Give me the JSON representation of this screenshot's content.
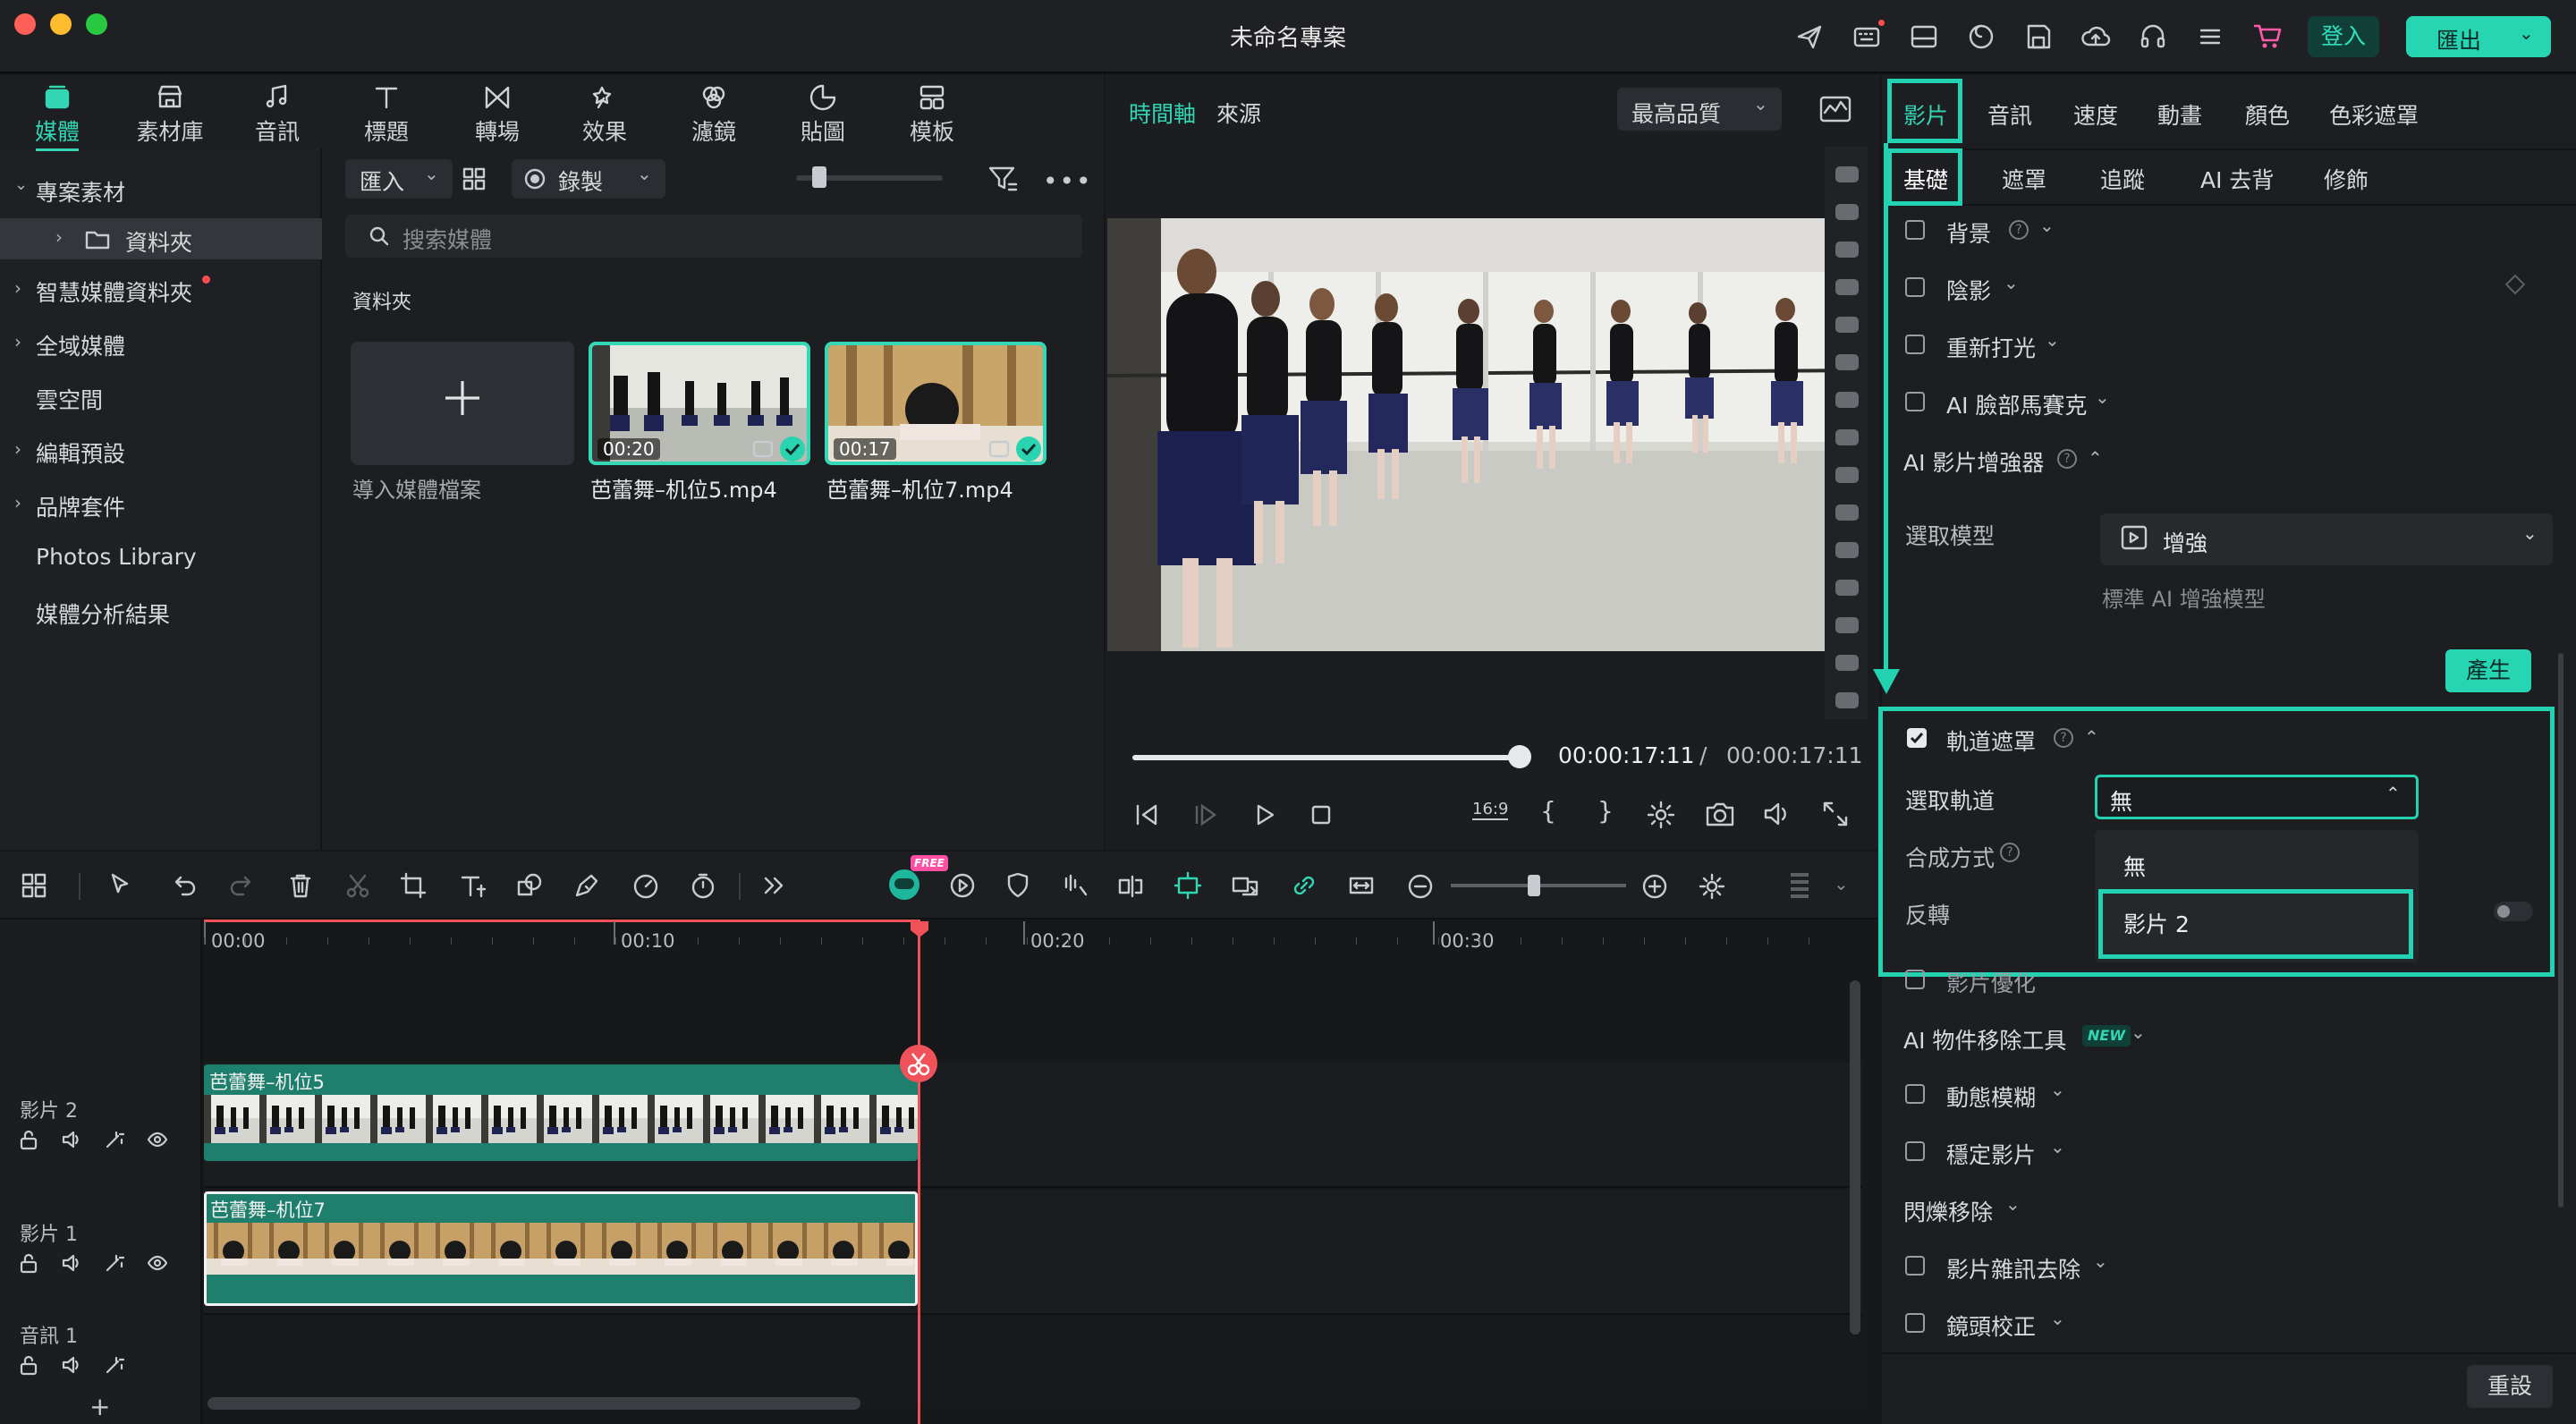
{
  "window": {
    "title": "未命名專案"
  },
  "titlebar": {
    "login_label": "登入",
    "export_label": "匯出"
  },
  "nav": {
    "items": [
      {
        "label": "媒體",
        "icon": "media-icon",
        "active": true
      },
      {
        "label": "素材庫",
        "icon": "store-icon"
      },
      {
        "label": "音訊",
        "icon": "music-icon"
      },
      {
        "label": "標題",
        "icon": "title-icon"
      },
      {
        "label": "轉場",
        "icon": "transition-icon"
      },
      {
        "label": "效果",
        "icon": "effect-icon"
      },
      {
        "label": "濾鏡",
        "icon": "filter-icon"
      },
      {
        "label": "貼圖",
        "icon": "sticker-icon"
      },
      {
        "label": "模板",
        "icon": "template-icon"
      }
    ]
  },
  "sidebar": {
    "project_media": "專案素材",
    "folder": "資料夾",
    "smart_media": "智慧媒體資料夾",
    "global_media": "全域媒體",
    "cloud": "雲空間",
    "edit_presets": "編輯預設",
    "brand_kit": "品牌套件",
    "photos_library": "Photos Library",
    "media_analysis": "媒體分析結果"
  },
  "media": {
    "import_label": "匯入",
    "record_label": "錄製",
    "search_placeholder": "搜索媒體",
    "folder_title": "資料夾",
    "import_tile_label": "導入媒體檔案",
    "files": [
      {
        "name": "芭蕾舞–机位5.mp4",
        "duration": "00:20"
      },
      {
        "name": "芭蕾舞–机位7.mp4",
        "duration": "00:17"
      }
    ]
  },
  "preview": {
    "tab_timeline": "時間軸",
    "tab_source": "來源",
    "quality": "最高品質",
    "current_time": "00:00:17:11",
    "separator": "/",
    "total_time": "00:00:17:11",
    "progress": 1.0,
    "aspect": "16:9"
  },
  "properties": {
    "tabs": [
      "影片",
      "音訊",
      "速度",
      "動畫",
      "顏色",
      "色彩遮罩"
    ],
    "subtabs": [
      "基礎",
      "遮罩",
      "追蹤",
      "AI 去背",
      "修飾"
    ],
    "rows": {
      "background": "背景",
      "shadow": "陰影",
      "relight": "重新打光",
      "ai_face_mosaic": "AI 臉部馬賽克",
      "ai_enhancer": "AI 影片增強器",
      "select_model": "選取模型",
      "model_value": "增強",
      "model_desc": "標準 AI 增強模型",
      "generate": "產生",
      "track_matte": "軌道遮罩",
      "select_track": "選取軌道",
      "select_track_value": "無",
      "blend_mode": "合成方式",
      "invert": "反轉",
      "video_optimize": "影片優化",
      "ai_object_removal": "AI 物件移除工具",
      "new_badge": "NEW",
      "motion_blur": "動態模糊",
      "stabilize": "穩定影片",
      "flicker_removal": "閃爍移除",
      "denoise": "影片雜訊去除",
      "lens_correction": "鏡頭校正",
      "reset": "重設"
    },
    "dropdown_options": [
      "無",
      "影片 2"
    ]
  },
  "timeline": {
    "ruler": [
      "00:00",
      "00:10",
      "00:20",
      "00:30"
    ],
    "tracks": [
      {
        "label": "影片 2",
        "clip": "芭蕾舞–机位5"
      },
      {
        "label": "影片 1",
        "clip": "芭蕾舞–机位7"
      },
      {
        "label": "音訊 1",
        "clip": ""
      }
    ],
    "free_badge": "FREE"
  },
  "colors": {
    "accent": "#23d2b0",
    "panel": "#1c1e21",
    "playhead": "#f0525a"
  }
}
